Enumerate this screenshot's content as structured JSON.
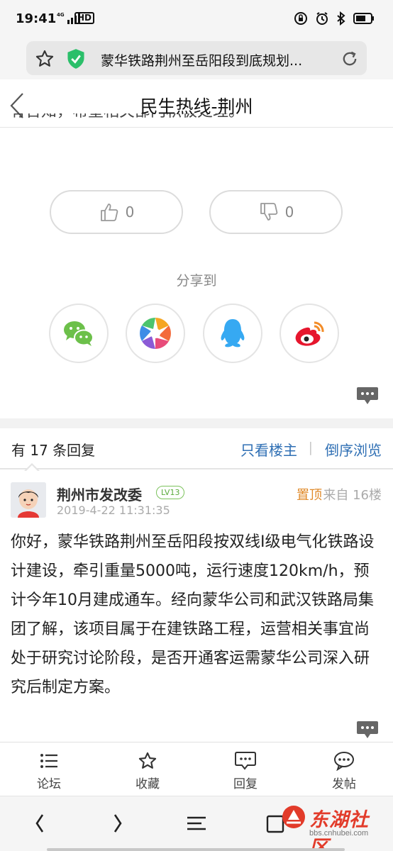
{
  "status_bar": {
    "time": "19:41",
    "network": "4G",
    "hd": "HD",
    "icons": [
      "lock-rotation-icon",
      "alarm-icon",
      "bluetooth-icon",
      "battery-icon"
    ]
  },
  "browser": {
    "url_title": "蒙华铁路荆州至岳阳段到底规划..."
  },
  "header": {
    "title": "民生热线-荆州"
  },
  "post_top": {
    "clipped_text": "有告知，希望相关部门积极处理。"
  },
  "votes": {
    "up_count": "0",
    "down_count": "0"
  },
  "share": {
    "label": "分享到",
    "targets": [
      "wechat",
      "moments",
      "qq",
      "weibo"
    ]
  },
  "replies": {
    "count_label": "有 17 条回复",
    "only_op": "只看楼主",
    "separator": "|",
    "reverse": "倒序浏览"
  },
  "reply": {
    "author": "荆州市发改委",
    "level": "LV13",
    "time": "2019-4-22 11:31:35",
    "pinned": "置顶",
    "floor": "来自 16楼",
    "body": "你好，蒙华铁路荆州至岳阳段按双线I级电气化铁路设计建设，牵引重量5000吨，运行速度120km/h，预计今年10月建成通车。经向蒙华公司和武汉铁路局集团了解，该项目属于在建铁路工程，运营相关事宜尚处于研究讨论阶段，是否开通客运需蒙华公司深入研究后制定方案。"
  },
  "toolbar": {
    "forum": "论坛",
    "favorite": "收藏",
    "reply": "回复",
    "post": "发帖"
  },
  "watermark": {
    "title": "东湖社区",
    "sub": "bbs.cnhubei.com"
  },
  "colors": {
    "link_blue": "#2f6fb4",
    "pinned_orange": "#e08a2a",
    "level_green": "#5aaa3c",
    "brand_red": "#e23b2a"
  }
}
